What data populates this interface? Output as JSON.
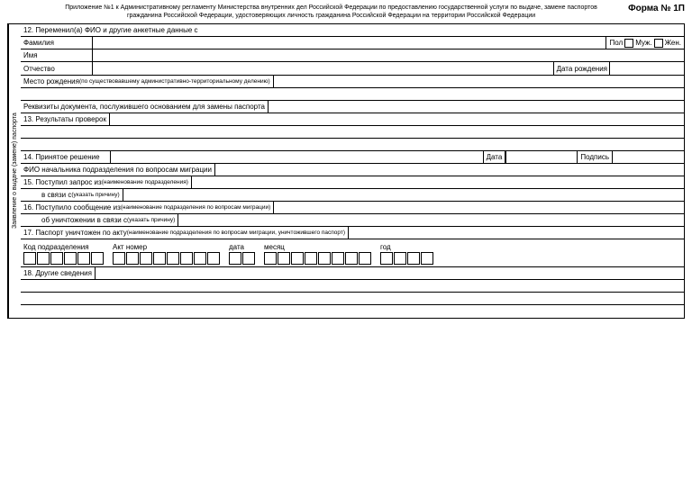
{
  "header": {
    "main_text": "Приложение №1 к Административному регламенту Министерства внутренних дел Российской Федерации по предоставлению государственной услуги по выдаче, замене паспортов гражданина Российской Федерации, удостоверяющих личность гражданина Российской Федерации на территории Российской Федерации",
    "forma_label": "Форма № 1П"
  },
  "side_label": "Заявление о выдаче (замене) паспорта",
  "sections": {
    "sec12_header": "12. Переменил(а) ФИО и другие анкетные данные с",
    "familiya_label": "Фамилия",
    "pol_label": "Пол",
    "muz_label": "Муж.",
    "zhen_label": "Жен.",
    "imya_label": "Имя",
    "otchestvo_label": "Отчество",
    "data_rozhdeniya_label": "Дата рождения",
    "mesto_rozhdeniya_label": "Место рождения",
    "mesto_rozhdeniya_sub": "(по существовавшему административно-территориальному делению)",
    "rekvizity_label": "Реквизиты документа, послужившего основанием для замены паспорта",
    "sec13_label": "13. Результаты проверок",
    "sec14_label": "14. Принятое решение",
    "data_label": "Дата",
    "podpis_label": "Подпись",
    "fio_nach_label": "ФИО начальника подразделения по вопросам миграции",
    "sec15_label": "15. Поступил запрос из",
    "sec15_sub": "(наименование подразделения)",
    "v_svyazi_label": "в связи с",
    "v_svyazi_sub": "(указать причину)",
    "sec16_label": "16. Поступило сообщение из",
    "sec16_sub": "(наименование подразделения по вопросам миграции)",
    "ob_unich_label": "об уничтожении в связи с",
    "ob_unich_sub": "(указать причину)",
    "sec17_label": "17. Паспорт уничтожен по акту",
    "sec17_sub": "(наименование подразделения по вопросам миграции, уничтожившего паспорт)",
    "kod_pod_label": "Код подразделения",
    "akt_nomer_label": "Акт номер",
    "data_code_label": "дата",
    "mesyac_label": "месяц",
    "god_label": "год",
    "sec18_label": "18. Другие сведения"
  }
}
